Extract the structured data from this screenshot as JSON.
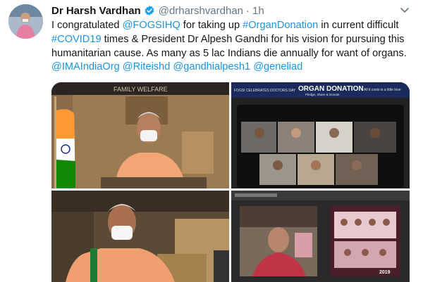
{
  "tweet": {
    "name": "Dr Harsh Vardhan",
    "handle": "@drharshvardhan",
    "separator": "·",
    "time": "1h",
    "segments": [
      {
        "t": "I congratulated ",
        "link": false
      },
      {
        "t": "@FOGSIHQ",
        "link": true
      },
      {
        "t": " for taking up ",
        "link": false
      },
      {
        "t": "#OrganDonation",
        "link": true
      },
      {
        "t": " in current difficult ",
        "link": false
      },
      {
        "t": "#COVID19",
        "link": true
      },
      {
        "t": " times & President Dr Alpesh Gandhi for his vision for pursuing this humanitarian cause. As many as 5 lac Indians die annually for want of organs. ",
        "link": false
      },
      {
        "t": "@IMAIndiaOrg",
        "link": true
      },
      {
        "t": " ",
        "link": false
      },
      {
        "t": "@Riteishd",
        "link": true
      },
      {
        "t": " ",
        "link": false
      },
      {
        "t": "@gandhialpesh1",
        "link": true
      },
      {
        "t": " ",
        "link": false
      },
      {
        "t": "@geneliad",
        "link": true
      }
    ]
  },
  "media": {
    "photo1": {
      "sign": "FAMILY WELFARE"
    },
    "photo2": {
      "banner_small": "FOGSI CELEBRATES DOCTORS DAY",
      "banner_title": "ORGAN DONATION",
      "banner_sub": "Pledge, Share & Donate",
      "banner_right": "All it costs is a little love"
    },
    "photo4": {
      "year": "2019"
    }
  },
  "colors": {
    "link": "#1b95e0",
    "text": "#14171a",
    "muted": "#657786",
    "verified": "#1da1f2"
  }
}
